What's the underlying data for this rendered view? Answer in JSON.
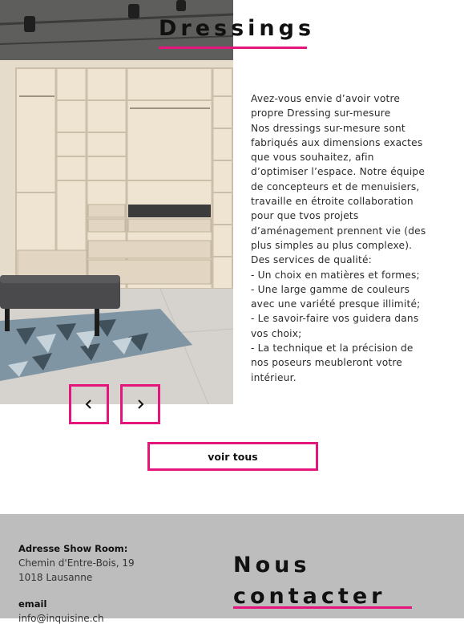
{
  "section": {
    "title": "Dressings",
    "description": [
      "Avez-vous envie d’avoir votre propre Dressing sur-mesure",
      "Nos dressings sur-mesure sont fabriqués aux dimensions exactes que vous souhaitez, afin d’optimiser l’espace. Notre équipe de concepteurs et de menuisiers, travaille en étroite collaboration pour que tvos projets d’aménagement prennent vie (des plus simples au plus complexe).",
      "Des services de qualité:",
      "- Un choix en matières et formes;",
      "- Une large gamme de couleurs avec une variété presque illimité;",
      "- Le savoir-faire vos guidera dans vos choix;",
      "- La technique et la précision de nos poseurs meubleront votre intérieur."
    ],
    "carousel": {
      "prev_icon": "chevron-left-icon",
      "next_icon": "chevron-right-icon"
    },
    "view_all_label": "voir tous"
  },
  "footer": {
    "address_label": "Adresse Show Room:",
    "address_line1": "Chemin d'Entre-Bois, 19",
    "address_line2": "1018 Lausanne",
    "email_label": "email",
    "email_value": "info@inquisine.ch",
    "contact_title_line1": "Nous",
    "contact_title_line2": "contacter"
  },
  "colors": {
    "accent": "#e5157e",
    "footer_bg": "#bdbdbd"
  }
}
